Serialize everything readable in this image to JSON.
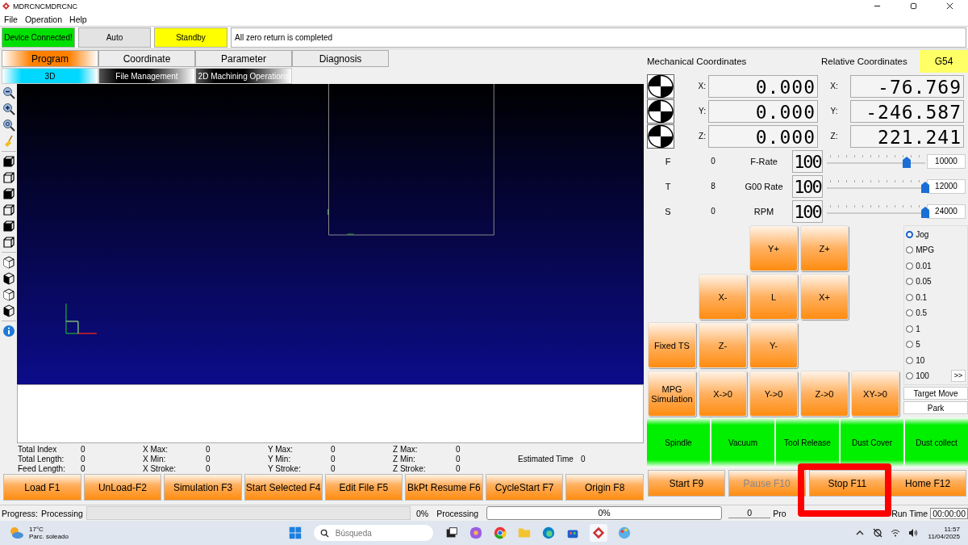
{
  "window": {
    "title": "MDRCNCMDRCNC"
  },
  "menu": [
    "File",
    "Operation",
    "Help"
  ],
  "status": {
    "connection": "Device Connected!",
    "mode": "Auto",
    "state": "Standby",
    "message": "All zero return is completed"
  },
  "tabs": [
    {
      "label": "Program",
      "selected": true
    },
    {
      "label": "Coordinate",
      "selected": false
    },
    {
      "label": "Parameter",
      "selected": false
    },
    {
      "label": "Diagnosis",
      "selected": false
    }
  ],
  "subtabs": [
    {
      "label": "3D",
      "selected": true
    },
    {
      "label": "File Management",
      "selected": false
    },
    {
      "label": "2D Machining Operations",
      "selected": false
    }
  ],
  "stats": [
    [
      {
        "label": "Total Index",
        "value": "0"
      },
      {
        "label": "Total Length:",
        "value": "0"
      },
      {
        "label": "Feed Length:",
        "value": "0"
      }
    ],
    [
      {
        "label": "X Max:",
        "value": "0"
      },
      {
        "label": "X Min:",
        "value": "0"
      },
      {
        "label": "X Stroke:",
        "value": "0"
      }
    ],
    [
      {
        "label": "Y Max:",
        "value": "0"
      },
      {
        "label": "Y Min:",
        "value": "0"
      },
      {
        "label": "Y Stroke:",
        "value": "0"
      }
    ],
    [
      {
        "label": "Z Max:",
        "value": "0"
      },
      {
        "label": "Z Min:",
        "value": "0"
      },
      {
        "label": "Z Stroke:",
        "value": "0"
      }
    ]
  ],
  "estimated": {
    "label": "Estimated Time",
    "value": "0"
  },
  "program_buttons": [
    {
      "label": "Load F1"
    },
    {
      "label": "UnLoad-F2"
    },
    {
      "label": "Simulation F3"
    },
    {
      "label": "Start Selected F4"
    },
    {
      "label": "Edit File F5"
    },
    {
      "label": "BkPt Resume F6"
    },
    {
      "label": "CycleStart F7"
    },
    {
      "label": "Origin F8"
    }
  ],
  "progress": {
    "label": "Progress:",
    "state": "Processing",
    "level": 0,
    "percent": "0%",
    "state_2": "Processing",
    "bar_2": {
      "level": 0,
      "percent": "0%"
    }
  },
  "coords": {
    "mechanical_title": "Mechanical Coordinates",
    "relative_title": "Relative Coordinates",
    "work_offset": "G54",
    "axes": [
      {
        "label": "X:",
        "mechanical": "0.000",
        "relative_label": "X:",
        "relative": "-76.769"
      },
      {
        "label": "Y:",
        "mechanical": "0.000",
        "relative_label": "Y:",
        "relative": "-246.587"
      },
      {
        "label": "Z:",
        "mechanical": "0.000",
        "relative_label": "Z:",
        "relative": "221.241"
      }
    ]
  },
  "rates": [
    {
      "letter": "F",
      "value": "0",
      "name": "F-Rate",
      "percent": "100",
      "level": 0.81,
      "max": "10000"
    },
    {
      "letter": "T",
      "value": "8",
      "name": "G00 Rate",
      "percent": "100",
      "level": 1,
      "max": "12000"
    },
    {
      "letter": "S",
      "value": "0",
      "name": "RPM",
      "percent": "100",
      "level": 1,
      "max": "24000"
    }
  ],
  "jog_rows": [
    [
      {
        "kind": "blank"
      },
      {
        "kind": "blank"
      },
      {
        "kind": "key",
        "label": "Y+"
      },
      {
        "kind": "key",
        "label": "Z+"
      }
    ],
    [
      {
        "kind": "blank"
      },
      {
        "kind": "key",
        "label": "X-"
      },
      {
        "kind": "key",
        "label": "L"
      },
      {
        "kind": "key",
        "label": "X+"
      }
    ],
    [
      {
        "kind": "key",
        "label": "Fixed TS"
      },
      {
        "kind": "key",
        "label": "Z-"
      },
      {
        "kind": "key",
        "label": "Y-"
      }
    ],
    [
      {
        "kind": "key",
        "label": "MPG Simulation"
      },
      {
        "kind": "key",
        "label": "X->0"
      },
      {
        "kind": "key",
        "label": "Y->0"
      },
      {
        "kind": "key",
        "label": "Z->0"
      },
      {
        "kind": "key",
        "label": "XY->0"
      }
    ]
  ],
  "step_modes": [
    {
      "label": "Jog",
      "selected": true
    },
    {
      "label": "MPG",
      "selected": false
    },
    {
      "label": "0.01",
      "selected": false
    },
    {
      "label": "0.05",
      "selected": false
    },
    {
      "label": "0.1",
      "selected": false
    },
    {
      "label": "0.5",
      "selected": false
    },
    {
      "label": "1",
      "selected": false
    },
    {
      "label": "5",
      "selected": false
    },
    {
      "label": "10",
      "selected": false
    },
    {
      "label": "100",
      "selected": false
    }
  ],
  "more_button": ">>",
  "target_move": "Target Move",
  "park": "Park",
  "outputs": [
    {
      "label": "Spindle",
      "on": true
    },
    {
      "label": "Vacuum",
      "on": true
    },
    {
      "label": "Tool Release",
      "on": true
    },
    {
      "label": "Dust Cover",
      "on": true
    },
    {
      "label": "Dust collect",
      "on": true
    }
  ],
  "machine_buttons": [
    {
      "label": "Start F9",
      "disabled": false
    },
    {
      "label": "Pause F10",
      "disabled": true
    },
    {
      "label": "Stop F11",
      "disabled": false
    },
    {
      "label": "Home F12",
      "disabled": false
    }
  ],
  "counters": {
    "count": "0",
    "processing": "Pro",
    "run_time_label": "Run Time",
    "run_time": "00:00:00"
  },
  "taskbar": {
    "temperature": "17°C",
    "weather": "Parc. soleado",
    "search_placeholder": "Búsqueda",
    "time": "11:57",
    "date": "11/04/2025"
  }
}
